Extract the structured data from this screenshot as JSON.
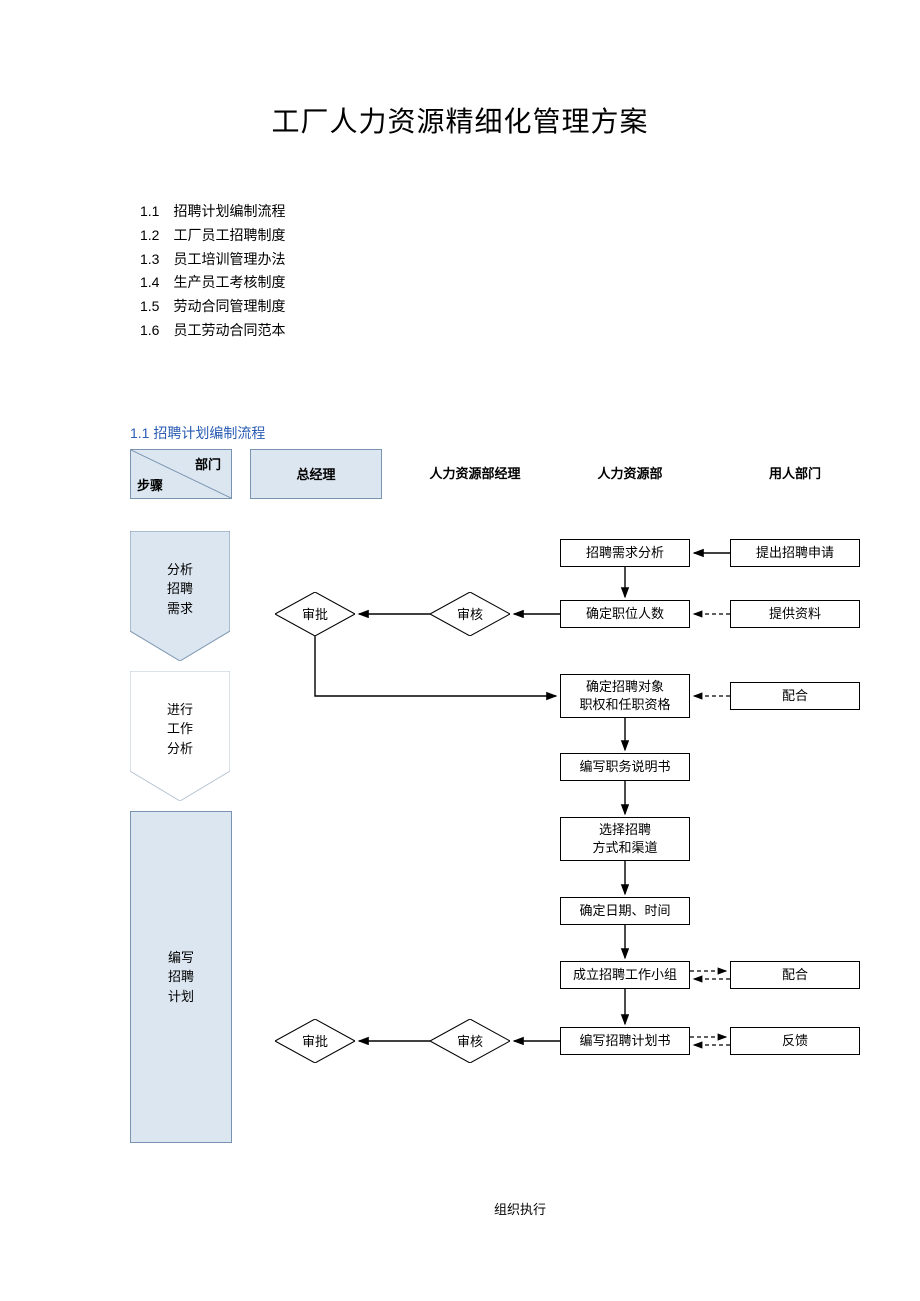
{
  "title": "工厂人力资源精细化管理方案",
  "toc": [
    {
      "num": "1.1",
      "label": "招聘计划编制流程"
    },
    {
      "num": "1.2",
      "label": "工厂员工招聘制度"
    },
    {
      "num": "1.3",
      "label": "员工培训管理办法"
    },
    {
      "num": "1.4",
      "label": "生产员工考核制度"
    },
    {
      "num": "1.5",
      "label": "劳动合同管理制度"
    },
    {
      "num": "1.6",
      "label": "员工劳动合同范本"
    }
  ],
  "section": {
    "heading": "1.1 招聘计划编制流程"
  },
  "header": {
    "dept": "部门",
    "step": "步骤",
    "gm": "总经理",
    "hr_manager": "人力资源部经理",
    "hr_dept": "人力资源部",
    "user_dept": "用人部门"
  },
  "steps": {
    "s1": "分析\n招聘\n需求",
    "s2": "进行\n工作\n分析",
    "s3": "编写\n招聘\n计划"
  },
  "boxes": {
    "b1": "招聘需求分析",
    "b2": "提出招聘申请",
    "b3": "确定职位人数",
    "b4": "提供资料",
    "b5": "确定招聘对象\n职权和任职资格",
    "b6": "配合",
    "b7": "编写职务说明书",
    "b8": "选择招聘\n方式和渠道",
    "b9": "确定日期、时间",
    "b10": "成立招聘工作小组",
    "b11": "配合",
    "b12": "编写招聘计划书",
    "b13": "反馈"
  },
  "diamonds": {
    "d1a": "审批",
    "d1b": "审核",
    "d2a": "审批",
    "d2b": "审核"
  },
  "footer": "组织执行"
}
